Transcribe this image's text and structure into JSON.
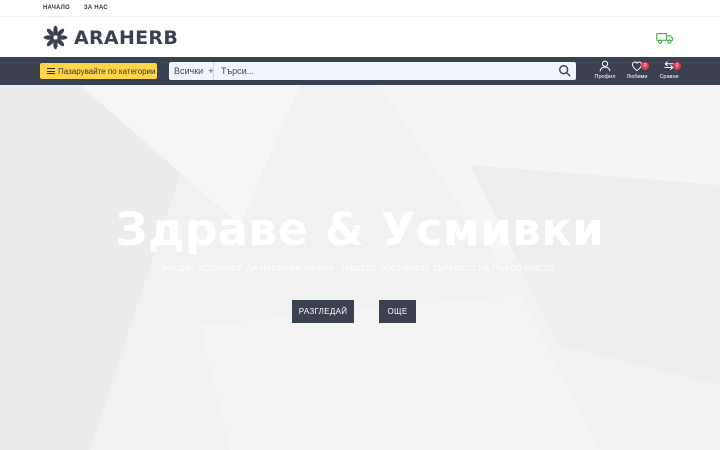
{
  "topnav": {
    "items": [
      "НАЧАЛО",
      "ЗА НАС"
    ]
  },
  "brand": {
    "name": "ARAHERB",
    "accent": "#3a4150",
    "truck_color": "#4caf50"
  },
  "navbar": {
    "categories_button": "Пазарувайте по категории",
    "search_category": "Всички",
    "search_category_plus": "+",
    "search_placeholder": "Търси...",
    "profile_label": "Профил",
    "favorites_label": "Любими",
    "favorites_count": "0",
    "compare_label": "Сравни",
    "compare_count": "0"
  },
  "hero": {
    "title": "Здраве & Усмивки",
    "subtitle": "ЗАЕДНО УСПЯВАМЕ ДА НАМЕРИМ НАЧИН , ЗАЩОТО ПОСТАВЯМЕ ЗДРАВЕТО НА ПЪРВО МЯСТО..",
    "browse_button": "РАЗГЛЕДАЙ",
    "more_button": "ОЩЕ"
  }
}
